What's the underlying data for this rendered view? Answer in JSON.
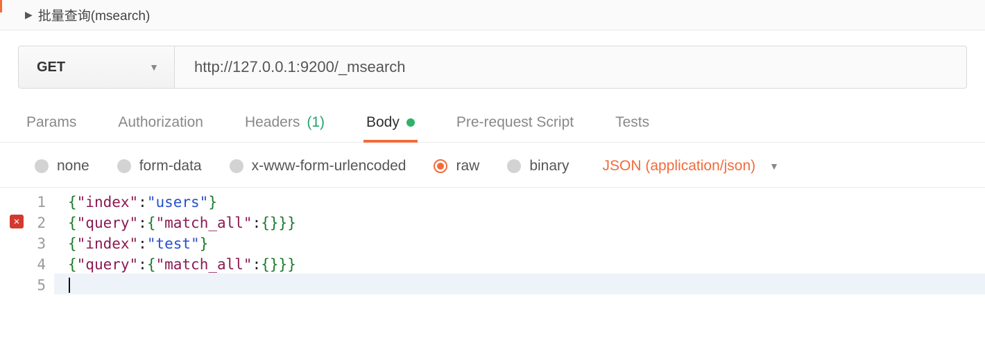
{
  "section": {
    "title": "批量查询(msearch)"
  },
  "request": {
    "method": "GET",
    "url": "http://127.0.0.1:9200/_msearch"
  },
  "tabs": {
    "params": "Params",
    "auth": "Authorization",
    "headers_label": "Headers",
    "headers_count": "(1)",
    "body": "Body",
    "prerequest": "Pre-request Script",
    "tests": "Tests",
    "active": "body"
  },
  "body_types": {
    "none": "none",
    "formdata": "form-data",
    "urlencoded": "x-www-form-urlencoded",
    "raw": "raw",
    "binary": "binary",
    "selected": "raw",
    "content_type": "JSON (application/json)"
  },
  "editor": {
    "error_line": 2,
    "lines": [
      {
        "n": "1",
        "tokens": [
          {
            "t": "{",
            "c": "brace"
          },
          {
            "t": "\"index\"",
            "c": "key"
          },
          {
            "t": ":",
            "c": "punc"
          },
          {
            "t": "\"users\"",
            "c": "str"
          },
          {
            "t": "}",
            "c": "brace"
          }
        ]
      },
      {
        "n": "2",
        "tokens": [
          {
            "t": "{",
            "c": "brace"
          },
          {
            "t": "\"query\"",
            "c": "key"
          },
          {
            "t": ":",
            "c": "punc"
          },
          {
            "t": "{",
            "c": "brace"
          },
          {
            "t": "\"match_all\"",
            "c": "key"
          },
          {
            "t": ":",
            "c": "punc"
          },
          {
            "t": "{",
            "c": "brace"
          },
          {
            "t": "}",
            "c": "brace"
          },
          {
            "t": "}",
            "c": "brace"
          },
          {
            "t": "}",
            "c": "brace"
          }
        ]
      },
      {
        "n": "3",
        "tokens": [
          {
            "t": "{",
            "c": "brace"
          },
          {
            "t": "\"index\"",
            "c": "key"
          },
          {
            "t": ":",
            "c": "punc"
          },
          {
            "t": "\"test\"",
            "c": "str"
          },
          {
            "t": "}",
            "c": "brace"
          }
        ]
      },
      {
        "n": "4",
        "tokens": [
          {
            "t": "{",
            "c": "brace"
          },
          {
            "t": "\"query\"",
            "c": "key"
          },
          {
            "t": ":",
            "c": "punc"
          },
          {
            "t": "{",
            "c": "brace"
          },
          {
            "t": "\"match_all\"",
            "c": "key"
          },
          {
            "t": ":",
            "c": "punc"
          },
          {
            "t": "{",
            "c": "brace"
          },
          {
            "t": "}",
            "c": "brace"
          },
          {
            "t": "}",
            "c": "brace"
          },
          {
            "t": "}",
            "c": "brace"
          }
        ]
      },
      {
        "n": "5",
        "tokens": [],
        "cursor": true
      }
    ]
  }
}
